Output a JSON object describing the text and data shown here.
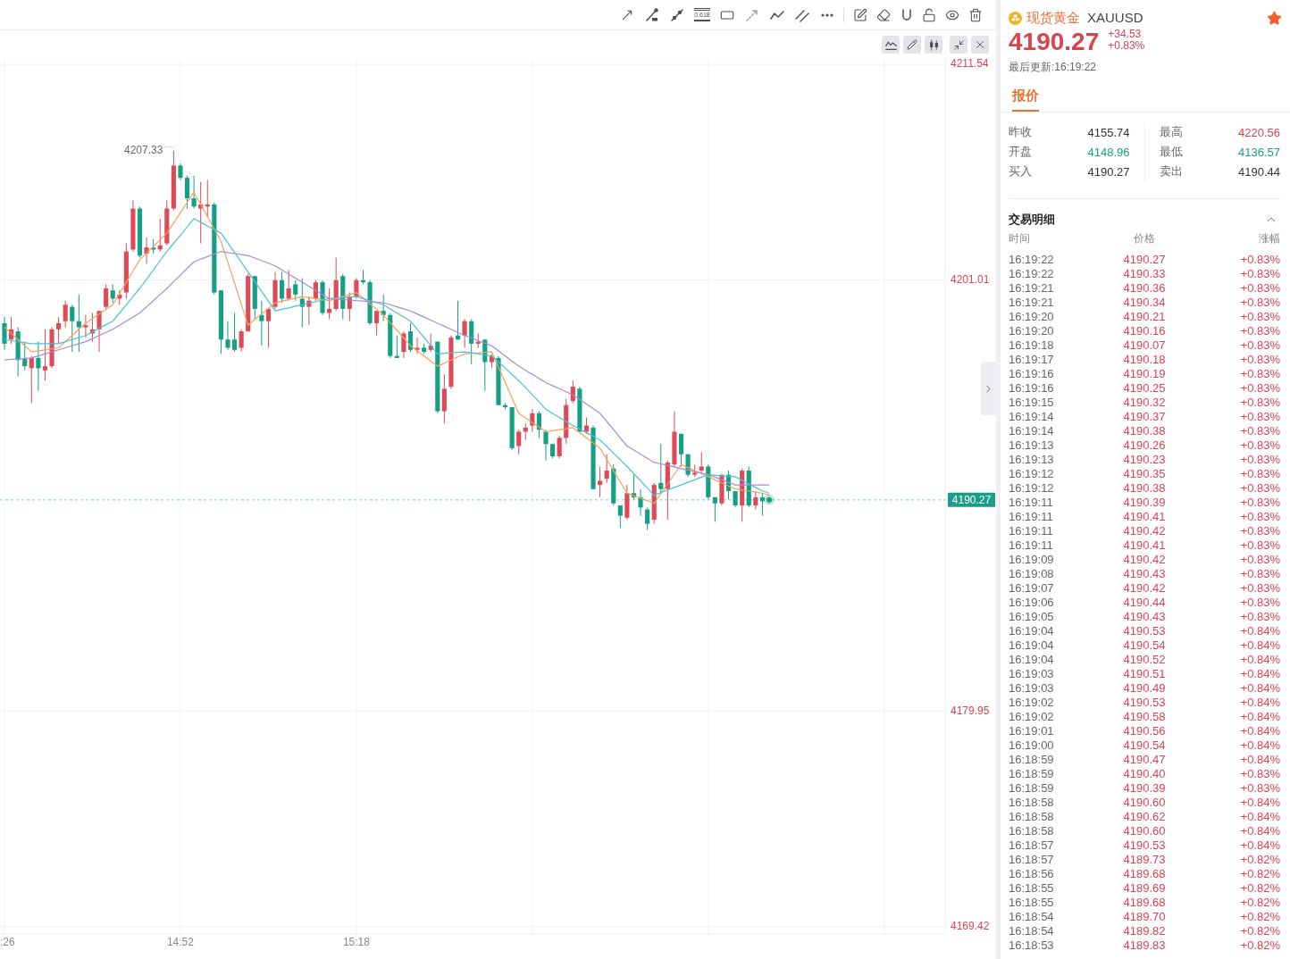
{
  "drawing_toolbar": {
    "fibonacci_label": "0.618"
  },
  "chart": {
    "chart_data": [
      {
        "type": "candlestick",
        "grid": true,
        "ylim": [
          4169.07,
          4211.85
        ],
        "yticks": [
          4169.42,
          4179.95,
          4201.01,
          4211.54
        ],
        "ref_lines": [
          {
            "axis": "y",
            "value": 4190.27,
            "label": "4190.27",
            "color": "#1a9e85",
            "line_style": "dashed"
          }
        ],
        "annotations": [
          "4207.33"
        ],
        "categories": [
          ":26",
          null,
          null,
          null,
          null,
          null,
          null,
          null,
          null,
          null,
          null,
          null,
          null,
          null,
          null,
          null,
          null,
          null,
          null,
          null,
          null,
          null,
          null,
          null,
          null,
          null,
          "14:52",
          null,
          null,
          null,
          null,
          null,
          null,
          null,
          null,
          null,
          null,
          null,
          null,
          null,
          null,
          null,
          null,
          null,
          null,
          null,
          null,
          null,
          null,
          null,
          null,
          null,
          "15:18",
          null,
          null,
          null,
          null,
          null,
          null,
          null,
          null,
          null,
          null,
          null,
          null,
          null,
          null,
          null,
          null,
          null,
          null,
          null,
          null,
          null,
          null,
          null,
          null,
          null,
          null,
          null,
          null,
          null,
          null,
          null,
          null,
          null,
          null,
          null,
          null,
          null,
          null,
          null,
          null,
          null,
          null,
          null,
          null,
          null,
          null,
          null,
          null,
          null,
          null,
          null,
          null,
          null,
          null,
          null,
          null,
          null,
          null,
          null,
          null,
          null
        ],
        "series": [
          {
            "type": "candlestick",
            "ohlc": [
              [
                4198.9,
                4199.2,
                4197.6,
                4197.9
              ],
              [
                4198.1,
                4199.2,
                4197.9,
                4198.6
              ],
              [
                4198.5,
                4198.7,
                4196.3,
                4197.1
              ],
              [
                4197.2,
                4198.0,
                4196.6,
                4196.8
              ],
              [
                4196.7,
                4197.3,
                4195.0,
                4197.2
              ],
              [
                4197.2,
                4198.0,
                4195.6,
                4196.7
              ],
              [
                4196.6,
                4198.6,
                4196.1,
                4196.8
              ],
              [
                4196.8,
                4198.7,
                4196.7,
                4198.6
              ],
              [
                4198.6,
                4199.2,
                4197.9,
                4198.9
              ],
              [
                4199.0,
                4200.0,
                4198.7,
                4199.8
              ],
              [
                4199.7,
                4199.8,
                4197.5,
                4199.0
              ],
              [
                4199.0,
                4200.3,
                4197.5,
                4198.7
              ],
              [
                4198.7,
                4199.3,
                4198.2,
                4198.8
              ],
              [
                4198.4,
                4199.4,
                4198.0,
                4198.6
              ],
              [
                4198.6,
                4199.5,
                4197.5,
                4199.5
              ],
              [
                4199.7,
                4200.8,
                4199.6,
                4200.6
              ],
              [
                4200.5,
                4200.8,
                4199.9,
                4200.1
              ],
              [
                4200.1,
                4200.5,
                4199.8,
                4200.3
              ],
              [
                4200.4,
                4202.8,
                4200.1,
                4202.4
              ],
              [
                4202.5,
                4204.9,
                4202.4,
                4204.5
              ],
              [
                4204.5,
                4204.6,
                4202.1,
                4202.2
              ],
              [
                4202.3,
                4203.1,
                4201.8,
                4202.6
              ],
              [
                4202.6,
                4203.0,
                4202.3,
                4202.5
              ],
              [
                4202.5,
                4204.0,
                4202.4,
                4202.7
              ],
              [
                4202.8,
                4204.9,
                4202.7,
                4204.5
              ],
              [
                4204.5,
                4207.33,
                4204.4,
                4206.6
              ],
              [
                4206.6,
                4206.7,
                4205.9,
                4206.0
              ],
              [
                4206.0,
                4206.1,
                4204.5,
                4205.0
              ],
              [
                4205.0,
                4206.1,
                4204.5,
                4204.6
              ],
              [
                4204.5,
                4205.8,
                4202.8,
                4204.7
              ],
              [
                4204.6,
                4205.9,
                4204.1,
                4204.7
              ],
              [
                4204.7,
                4204.8,
                4200.3,
                4200.4
              ],
              [
                4200.5,
                4200.5,
                4197.4,
                4198.1
              ],
              [
                4198.1,
                4199.0,
                4197.6,
                4197.7
              ],
              [
                4198.1,
                4199.4,
                4197.5,
                4197.6
              ],
              [
                4197.7,
                4198.6,
                4197.5,
                4198.5
              ],
              [
                4198.5,
                4201.3,
                4198.5,
                4201.2
              ],
              [
                4201.2,
                4201.2,
                4199.1,
                4199.6
              ],
              [
                4199.3,
                4200.0,
                4197.8,
                4199.0
              ],
              [
                4199.0,
                4199.6,
                4197.7,
                4199.6
              ],
              [
                4199.7,
                4201.4,
                4199.6,
                4201.0
              ],
              [
                4201.0,
                4201.4,
                4199.9,
                4200.1
              ],
              [
                4200.1,
                4201.5,
                4200.0,
                4200.6
              ],
              [
                4200.8,
                4201.0,
                4200.0,
                4200.3
              ],
              [
                4200.1,
                4201.1,
                4198.7,
                4199.7
              ],
              [
                4199.7,
                4200.2,
                4198.8,
                4200.0
              ],
              [
                4200.1,
                4201.0,
                4200.0,
                4200.9
              ],
              [
                4200.9,
                4201.0,
                4199.3,
                4199.4
              ],
              [
                4199.4,
                4200.6,
                4199.1,
                4199.6
              ],
              [
                4199.6,
                4202.1,
                4199.5,
                4201.0
              ],
              [
                4201.2,
                4201.3,
                4199.1,
                4199.6
              ],
              [
                4199.6,
                4200.4,
                4199.0,
                4200.2
              ],
              [
                4200.2,
                4201.1,
                4200.1,
                4201.0
              ],
              [
                4201.0,
                4201.5,
                4200.8,
                4200.9
              ],
              [
                4200.9,
                4201.0,
                4198.8,
                4198.9
              ],
              [
                4198.9,
                4199.5,
                4198.3,
                4199.5
              ],
              [
                4199.5,
                4200.3,
                4199.0,
                4199.3
              ],
              [
                4199.3,
                4199.4,
                4197.2,
                4197.3
              ],
              [
                4197.3,
                4198.3,
                4197.2,
                4197.2
              ],
              [
                4197.5,
                4198.5,
                4197.2,
                4198.4
              ],
              [
                4198.5,
                4198.9,
                4197.5,
                4197.6
              ],
              [
                4197.6,
                4198.2,
                4197.4,
                4197.7
              ],
              [
                4197.7,
                4197.9,
                4197.4,
                4197.5
              ],
              [
                4197.6,
                4198.4,
                4197.5,
                4197.8
              ],
              [
                4198.0,
                4198.0,
                4194.5,
                4194.6
              ],
              [
                4194.6,
                4196.4,
                4194.0,
                4195.7
              ],
              [
                4195.8,
                4198.3,
                4195.7,
                4198.2
              ],
              [
                4198.3,
                4200.0,
                4198.1,
                4198.1
              ],
              [
                4198.3,
                4199.1,
                4197.7,
                4199.0
              ],
              [
                4199.0,
                4199.1,
                4196.9,
                4197.9
              ],
              [
                4197.9,
                4198.4,
                4197.7,
                4198.0
              ],
              [
                4198.1,
                4198.1,
                4195.6,
                4197.0
              ],
              [
                4197.0,
                4197.4,
                4196.7,
                4197.3
              ],
              [
                4197.2,
                4197.3,
                4194.9,
                4194.9
              ],
              [
                4194.9,
                4195.0,
                4194.7,
                4194.8
              ],
              [
                4194.8,
                4194.8,
                4192.7,
                4192.8
              ],
              [
                4192.9,
                4193.7,
                4192.5,
                4193.6
              ],
              [
                4193.6,
                4194.0,
                4193.2,
                4193.8
              ],
              [
                4193.9,
                4194.7,
                4193.6,
                4194.5
              ],
              [
                4194.5,
                4194.6,
                4193.3,
                4193.7
              ],
              [
                4193.6,
                4193.7,
                4192.2,
                4193.0
              ],
              [
                4193.0,
                4193.0,
                4192.3,
                4192.4
              ],
              [
                4192.4,
                4193.4,
                4192.3,
                4193.3
              ],
              [
                4193.3,
                4195.2,
                4193.0,
                4194.9
              ],
              [
                4195.1,
                4196.1,
                4195.0,
                4195.8
              ],
              [
                4195.7,
                4195.8,
                4193.6,
                4193.6
              ],
              [
                4193.6,
                4194.3,
                4193.5,
                4193.9
              ],
              [
                4193.8,
                4193.9,
                4190.8,
                4190.8
              ],
              [
                4191.0,
                4191.9,
                4190.4,
                4191.2
              ],
              [
                4191.3,
                4192.5,
                4191.1,
                4191.7
              ],
              [
                4191.8,
                4192.0,
                4190.0,
                4190.1
              ],
              [
                4190.0,
                4190.0,
                4188.9,
                4189.5
              ],
              [
                4189.4,
                4191.0,
                4189.3,
                4190.6
              ],
              [
                4190.6,
                4191.5,
                4190.3,
                4190.4
              ],
              [
                4190.4,
                4190.8,
                4189.5,
                4189.9
              ],
              [
                4189.8,
                4189.9,
                4188.8,
                4189.1
              ],
              [
                4189.3,
                4191.1,
                4189.1,
                4191.0
              ],
              [
                4191.1,
                4193.0,
                4190.6,
                4190.8
              ],
              [
                4190.8,
                4192.2,
                4189.3,
                4192.1
              ],
              [
                4192.0,
                4194.6,
                4191.9,
                4193.6
              ],
              [
                4193.5,
                4193.5,
                4191.9,
                4192.5
              ],
              [
                4192.5,
                4192.5,
                4191.4,
                4191.5
              ],
              [
                4191.5,
                4192.0,
                4191.4,
                4191.6
              ],
              [
                4191.7,
                4192.6,
                4191.6,
                4191.9
              ],
              [
                4191.9,
                4192.0,
                4190.3,
                4190.4
              ],
              [
                4190.4,
                4190.4,
                4189.2,
                4190.1
              ],
              [
                4190.1,
                4191.5,
                4190.0,
                4191.5
              ],
              [
                4191.5,
                4191.7,
                4190.3,
                4190.7
              ],
              [
                4190.7,
                4190.7,
                4189.9,
                4190.0
              ],
              [
                4190.0,
                4191.8,
                4189.2,
                4191.7
              ],
              [
                4191.7,
                4191.9,
                4189.9,
                4190.0
              ],
              [
                4190.0,
                4190.7,
                4189.8,
                4190.4
              ],
              [
                4190.4,
                4190.6,
                4189.5,
                4190.2
              ],
              [
                4190.2,
                4190.4,
                4190.1,
                4190.27
              ]
            ]
          },
          {
            "type": "line",
            "color": "#f5a25d",
            "values": [
              4198.7,
              4198.4,
              4198.1,
              4197.8,
              4197.5,
              4197.55,
              4197.6,
              4197.65,
              4197.7,
              4198.0,
              4198.3,
              4198.6,
              4198.9,
              4199.13,
              4199.35,
              4199.58,
              4199.8,
              4200.35,
              4200.9,
              4201.45,
              4202.0,
              4202.33,
              4202.65,
              4202.98,
              4203.3,
              4203.8,
              4204.3,
              4204.8,
              4205.3,
              4204.7,
              4204.1,
              4203.5,
              4202.9,
              4201.88,
              4200.85,
              4199.83,
              4198.8,
              4199.08,
              4199.35,
              4199.63,
              4199.9,
              4199.98,
              4200.05,
              4200.13,
              4200.2,
              4200.15,
              4200.1,
              4200.05,
              4200.0,
              4200.1,
              4200.2,
              4200.3,
              4200.4,
              4200.13,
              4199.85,
              4199.58,
              4199.3,
              4198.93,
              4198.55,
              4198.18,
              4197.8,
              4197.55,
              4197.3,
              4197.05,
              4196.8,
              4196.95,
              4197.1,
              4197.25,
              4197.4,
              4197.43,
              4197.45,
              4197.48,
              4197.5,
              4196.75,
              4196.0,
              4195.25,
              4194.5,
              4194.28,
              4194.05,
              4193.83,
              4193.6,
              4193.65,
              4193.7,
              4193.75,
              4193.8,
              4193.55,
              4193.3,
              4193.05,
              4192.8,
              4192.25,
              4191.7,
              4191.15,
              4190.6,
              4190.48,
              4190.35,
              4190.23,
              4190.1,
              4190.58,
              4191.05,
              4191.53,
              4192.0,
              4191.85,
              4191.7,
              4191.55,
              4191.4,
              4191.25,
              4191.1,
              4190.95,
              4190.8,
              4190.75,
              4190.7,
              4190.65,
              4190.6,
              4190.5
            ]
          },
          {
            "type": "line",
            "color": "#4cc2d6",
            "values": [
              4198.1,
              4198.05,
              4198.0,
              4197.95,
              4197.9,
              4197.9,
              4197.9,
              4197.9,
              4197.9,
              4198.0,
              4198.1,
              4198.2,
              4198.3,
              4198.48,
              4198.65,
              4198.83,
              4199.0,
              4199.4,
              4199.8,
              4200.2,
              4200.6,
              4201.05,
              4201.5,
              4201.95,
              4202.4,
              4202.8,
              4203.2,
              4203.6,
              4204.0,
              4203.83,
              4203.65,
              4203.48,
              4203.3,
              4202.83,
              4202.35,
              4201.88,
              4201.4,
              4200.93,
              4200.45,
              4199.98,
              4199.5,
              4199.58,
              4199.65,
              4199.73,
              4199.8,
              4199.88,
              4199.95,
              4200.03,
              4200.1,
              4200.13,
              4200.15,
              4200.18,
              4200.2,
              4200.1,
              4200.0,
              4199.9,
              4199.8,
              4199.6,
              4199.4,
              4199.2,
              4199.0,
              4198.6,
              4198.2,
              4197.8,
              4197.4,
              4197.43,
              4197.45,
              4197.48,
              4197.5,
              4197.45,
              4197.4,
              4197.35,
              4197.3,
              4197.0,
              4196.7,
              4196.4,
              4196.1,
              4195.75,
              4195.4,
              4195.05,
              4194.7,
              4194.5,
              4194.3,
              4194.1,
              4193.9,
              4193.73,
              4193.55,
              4193.38,
              4193.2,
              4192.88,
              4192.55,
              4192.23,
              4191.9,
              4191.55,
              4191.2,
              4190.85,
              4190.5,
              4190.63,
              4190.75,
              4190.88,
              4191.0,
              4191.13,
              4191.25,
              4191.38,
              4191.5,
              4191.48,
              4191.45,
              4191.43,
              4191.4,
              4191.23,
              4191.05,
              4190.88,
              4190.7,
              4190.6
            ]
          },
          {
            "type": "line",
            "color": "#a68bd8",
            "values": [
              4197.1,
              4197.13,
              4197.15,
              4197.18,
              4197.2,
              4197.3,
              4197.4,
              4197.5,
              4197.6,
              4197.7,
              4197.8,
              4197.9,
              4198.0,
              4198.15,
              4198.3,
              4198.45,
              4198.6,
              4198.8,
              4199.0,
              4199.2,
              4199.4,
              4199.7,
              4200.0,
              4200.3,
              4200.6,
              4200.93,
              4201.25,
              4201.58,
              4201.9,
              4202.03,
              4202.15,
              4202.28,
              4202.4,
              4202.35,
              4202.3,
              4202.25,
              4202.2,
              4202.08,
              4201.95,
              4201.83,
              4201.7,
              4201.5,
              4201.3,
              4201.1,
              4200.9,
              4200.7,
              4200.5,
              4200.3,
              4200.1,
              4200.08,
              4200.05,
              4200.03,
              4200.0,
              4199.98,
              4199.95,
              4199.93,
              4199.9,
              4199.8,
              4199.7,
              4199.6,
              4199.5,
              4199.35,
              4199.2,
              4199.05,
              4198.9,
              4198.75,
              4198.6,
              4198.45,
              4198.3,
              4198.18,
              4198.05,
              4197.93,
              4197.8,
              4197.55,
              4197.3,
              4197.05,
              4196.8,
              4196.6,
              4196.4,
              4196.2,
              4196.0,
              4195.85,
              4195.7,
              4195.55,
              4195.4,
              4195.18,
              4194.95,
              4194.73,
              4194.5,
              4194.1,
              4193.7,
              4193.3,
              4192.9,
              4192.7,
              4192.5,
              4192.3,
              4192.1,
              4192.03,
              4191.95,
              4191.88,
              4191.8,
              4191.73,
              4191.65,
              4191.58,
              4191.5,
              4191.38,
              4191.25,
              4191.13,
              4191.0,
              4191.0,
              4191.0,
              4191.0,
              4191.0,
              4191.0
            ]
          }
        ]
      }
    ]
  },
  "quote": {
    "name": "现货黄金",
    "symbol": "XAUUSD",
    "favorite": true,
    "price": "4190.27",
    "change": "+34.53",
    "change_percent": "+0.83%",
    "updated": "最后更新:16:19:22"
  },
  "tabs": [
    {
      "label": "报价",
      "selected": true
    }
  ],
  "stat_columns": [
    [
      {
        "label": "昨收",
        "value": "4155.74",
        "color": "#333333"
      },
      {
        "label": "开盘",
        "value": "4148.96",
        "color": "#1a9e85"
      },
      {
        "label": "买入",
        "value": "4190.27",
        "color": "#333333"
      }
    ],
    [
      {
        "label": "最高",
        "value": "4220.56",
        "color": "#d9434f"
      },
      {
        "label": "最低",
        "value": "4136.57",
        "color": "#1a9e85"
      },
      {
        "label": "卖出",
        "value": "4190.44",
        "color": "#333333"
      }
    ]
  ],
  "trades": {
    "title": "交易明细",
    "expanded": true,
    "columns": [
      "时间",
      "价格",
      "涨幅"
    ],
    "rows": [
      {
        "time": "16:19:22",
        "price": "4190.27",
        "change": "+0.83%"
      },
      {
        "time": "16:19:22",
        "price": "4190.33",
        "change": "+0.83%"
      },
      {
        "time": "16:19:21",
        "price": "4190.36",
        "change": "+0.83%"
      },
      {
        "time": "16:19:21",
        "price": "4190.34",
        "change": "+0.83%"
      },
      {
        "time": "16:19:20",
        "price": "4190.21",
        "change": "+0.83%"
      },
      {
        "time": "16:19:20",
        "price": "4190.16",
        "change": "+0.83%"
      },
      {
        "time": "16:19:18",
        "price": "4190.07",
        "change": "+0.83%"
      },
      {
        "time": "16:19:17",
        "price": "4190.18",
        "change": "+0.83%"
      },
      {
        "time": "16:19:16",
        "price": "4190.19",
        "change": "+0.83%"
      },
      {
        "time": "16:19:16",
        "price": "4190.25",
        "change": "+0.83%"
      },
      {
        "time": "16:19:15",
        "price": "4190.32",
        "change": "+0.83%"
      },
      {
        "time": "16:19:14",
        "price": "4190.37",
        "change": "+0.83%"
      },
      {
        "time": "16:19:14",
        "price": "4190.38",
        "change": "+0.83%"
      },
      {
        "time": "16:19:13",
        "price": "4190.26",
        "change": "+0.83%"
      },
      {
        "time": "16:19:13",
        "price": "4190.23",
        "change": "+0.83%"
      },
      {
        "time": "16:19:12",
        "price": "4190.35",
        "change": "+0.83%"
      },
      {
        "time": "16:19:12",
        "price": "4190.38",
        "change": "+0.83%"
      },
      {
        "time": "16:19:11",
        "price": "4190.39",
        "change": "+0.83%"
      },
      {
        "time": "16:19:11",
        "price": "4190.41",
        "change": "+0.83%"
      },
      {
        "time": "16:19:11",
        "price": "4190.42",
        "change": "+0.83%"
      },
      {
        "time": "16:19:11",
        "price": "4190.41",
        "change": "+0.83%"
      },
      {
        "time": "16:19:09",
        "price": "4190.42",
        "change": "+0.83%"
      },
      {
        "time": "16:19:08",
        "price": "4190.43",
        "change": "+0.83%"
      },
      {
        "time": "16:19:07",
        "price": "4190.42",
        "change": "+0.83%"
      },
      {
        "time": "16:19:06",
        "price": "4190.44",
        "change": "+0.83%"
      },
      {
        "time": "16:19:05",
        "price": "4190.43",
        "change": "+0.83%"
      },
      {
        "time": "16:19:04",
        "price": "4190.53",
        "change": "+0.84%"
      },
      {
        "time": "16:19:04",
        "price": "4190.54",
        "change": "+0.84%"
      },
      {
        "time": "16:19:04",
        "price": "4190.52",
        "change": "+0.84%"
      },
      {
        "time": "16:19:03",
        "price": "4190.51",
        "change": "+0.84%"
      },
      {
        "time": "16:19:03",
        "price": "4190.49",
        "change": "+0.84%"
      },
      {
        "time": "16:19:02",
        "price": "4190.53",
        "change": "+0.84%"
      },
      {
        "time": "16:19:02",
        "price": "4190.58",
        "change": "+0.84%"
      },
      {
        "time": "16:19:01",
        "price": "4190.56",
        "change": "+0.84%"
      },
      {
        "time": "16:19:00",
        "price": "4190.54",
        "change": "+0.84%"
      },
      {
        "time": "16:18:59",
        "price": "4190.47",
        "change": "+0.84%"
      },
      {
        "time": "16:18:59",
        "price": "4190.40",
        "change": "+0.83%"
      },
      {
        "time": "16:18:59",
        "price": "4190.39",
        "change": "+0.83%"
      },
      {
        "time": "16:18:58",
        "price": "4190.60",
        "change": "+0.84%"
      },
      {
        "time": "16:18:58",
        "price": "4190.62",
        "change": "+0.84%"
      },
      {
        "time": "16:18:58",
        "price": "4190.60",
        "change": "+0.84%"
      },
      {
        "time": "16:18:57",
        "price": "4190.53",
        "change": "+0.84%"
      },
      {
        "time": "16:18:57",
        "price": "4189.73",
        "change": "+0.82%"
      },
      {
        "time": "16:18:56",
        "price": "4189.68",
        "change": "+0.82%"
      },
      {
        "time": "16:18:55",
        "price": "4189.69",
        "change": "+0.82%"
      },
      {
        "time": "16:18:55",
        "price": "4189.68",
        "change": "+0.82%"
      },
      {
        "time": "16:18:54",
        "price": "4189.70",
        "change": "+0.82%"
      },
      {
        "time": "16:18:54",
        "price": "4189.82",
        "change": "+0.82%"
      },
      {
        "time": "16:18:53",
        "price": "4189.83",
        "change": "+0.82%"
      }
    ]
  }
}
